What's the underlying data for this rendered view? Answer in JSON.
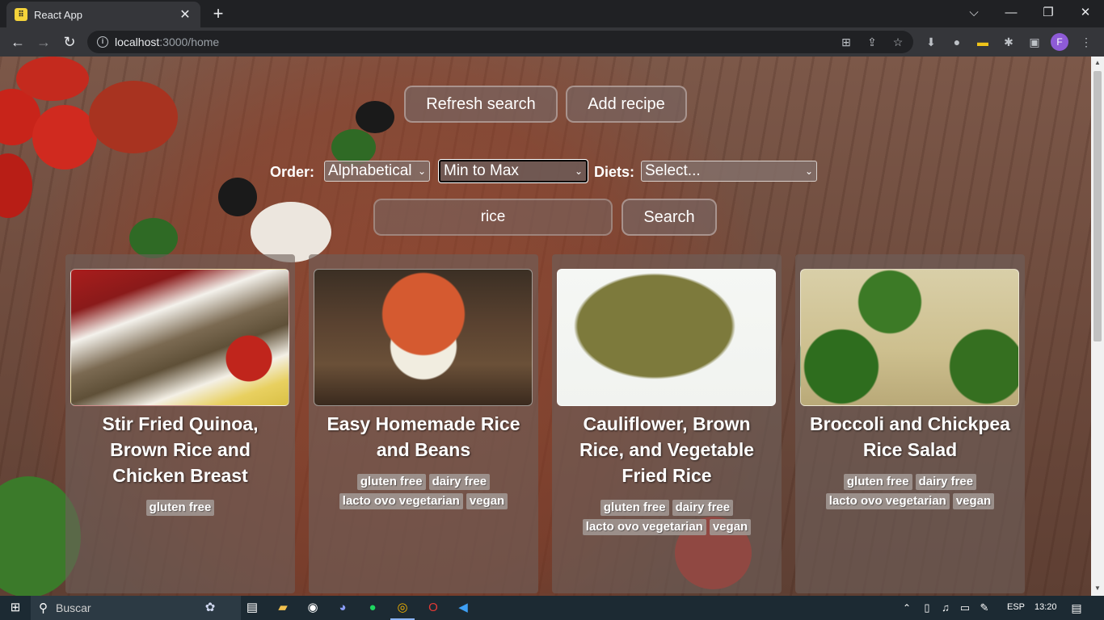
{
  "browser": {
    "tab_title": "React App",
    "tab_close": "✕",
    "new_tab": "+",
    "url_host": "localhost",
    "url_rest": ":3000/home",
    "profile_initial": "F",
    "window_controls": [
      "⌵",
      "—",
      "❐",
      "✕"
    ]
  },
  "page": {
    "refresh_label": "Refresh search",
    "add_recipe_label": "Add recipe",
    "order_label": "Order:",
    "order_value": "Alphabetical",
    "direction_value": "Min to Max",
    "diets_label": "Diets:",
    "diets_value": "Select...",
    "search_value": "rice",
    "search_button": "Search"
  },
  "recipes": [
    {
      "title": "Stir Fried Quinoa, Brown Rice and Chicken Breast",
      "tags": [
        "gluten free"
      ]
    },
    {
      "title": "Easy Homemade Rice and Beans",
      "tags": [
        "gluten free",
        "dairy free",
        "lacto ovo vegetarian",
        "vegan"
      ]
    },
    {
      "title": "Cauliflower, Brown Rice, and Vegetable Fried Rice",
      "tags": [
        "gluten free",
        "dairy free",
        "lacto ovo vegetarian",
        "vegan"
      ]
    },
    {
      "title": "Broccoli and Chickpea Rice Salad",
      "tags": [
        "gluten free",
        "dairy free",
        "lacto ovo vegetarian",
        "vegan"
      ]
    }
  ],
  "taskbar": {
    "search_placeholder": "Buscar",
    "language": "ESP",
    "time": "13:20"
  }
}
